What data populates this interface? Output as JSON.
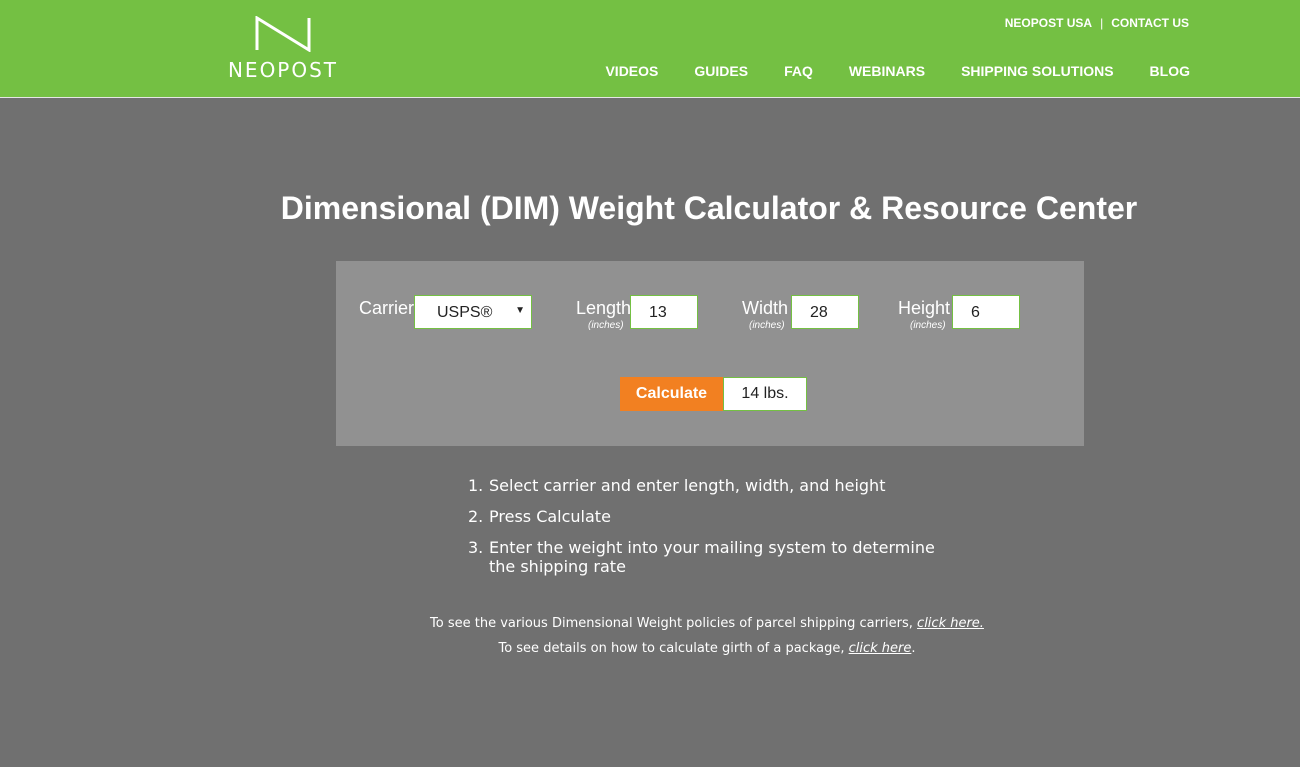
{
  "header": {
    "logo_text": "NEOPOST",
    "top_links": [
      "NEOPOST USA",
      "CONTACT US"
    ],
    "top_separator": "|",
    "nav": [
      "VIDEOS",
      "GUIDES",
      "FAQ",
      "WEBINARS",
      "SHIPPING SOLUTIONS",
      "BLOG"
    ]
  },
  "main": {
    "title": "Dimensional (DIM) Weight Calculator & Resource Center",
    "calculator": {
      "carrier_label": "Carrier",
      "carrier_value": "USPS®",
      "length_label": "Length",
      "length_unit": "(inches)",
      "length_value": "13",
      "width_label": "Width",
      "width_unit": "(inches)",
      "width_value": "28",
      "height_label": "Height",
      "height_unit": "(inches)",
      "height_value": "6",
      "calculate_label": "Calculate",
      "result": "14 lbs."
    },
    "steps": [
      {
        "num": "1.",
        "text": "Select carrier and enter length, width, and height"
      },
      {
        "num": "2.",
        "text": "Press Calculate"
      },
      {
        "num": "3.",
        "text": "Enter the weight into your mailing system to determine the shipping rate"
      }
    ],
    "notes": {
      "line1_text": "To see the various Dimensional Weight policies of parcel shipping carriers, ",
      "line1_link": "click here.",
      "line2_text": "To see details on how to calculate girth of a package, ",
      "line2_link": "click here",
      "line2_end": "."
    }
  },
  "colors": {
    "header_green": "#74c043",
    "page_gray": "#707070",
    "panel_gray": "#919191",
    "button_orange": "#f28021"
  }
}
